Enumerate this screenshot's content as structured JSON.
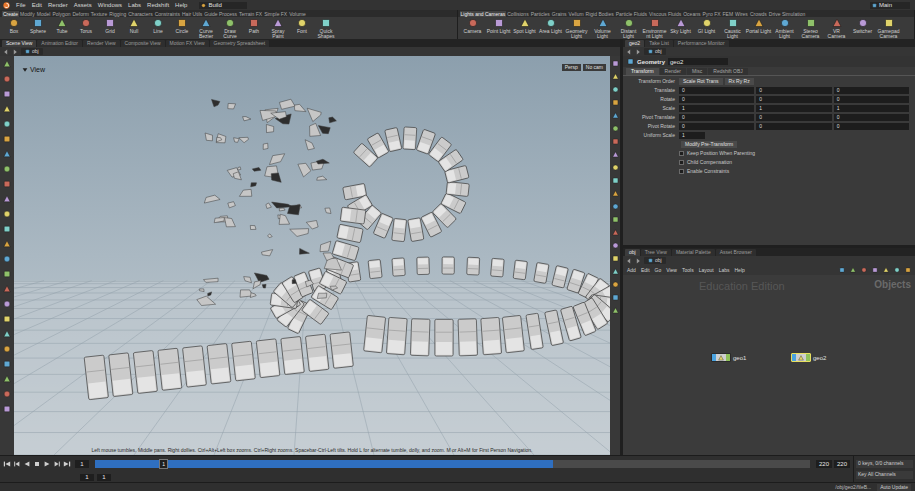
{
  "menu_bar": {
    "items": [
      "File",
      "Edit",
      "Render",
      "Assets",
      "Windows",
      "Labs",
      "Redshift",
      "Help"
    ],
    "desktop": "Build",
    "main": "Main"
  },
  "shelf": {
    "left_tabs": [
      {
        "label": "Create",
        "selected": true
      },
      {
        "label": "Modify",
        "selected": false
      },
      {
        "label": "Model",
        "selected": false
      },
      {
        "label": "Polygon",
        "selected": false
      },
      {
        "label": "Deform",
        "selected": false
      },
      {
        "label": "Texture",
        "selected": false
      },
      {
        "label": "Rigging",
        "selected": false
      },
      {
        "label": "Characters",
        "selected": false
      },
      {
        "label": "Constraints",
        "selected": false
      },
      {
        "label": "Hair Utils",
        "selected": false
      },
      {
        "label": "Guide Process",
        "selected": false
      },
      {
        "label": "Terrain FX",
        "selected": false
      },
      {
        "label": "Simple FX",
        "selected": false
      },
      {
        "label": "Volume",
        "selected": false
      }
    ],
    "left_tools": [
      "Box",
      "Sphere",
      "Tube",
      "Torus",
      "Grid",
      "Null",
      "Line",
      "Circle",
      "Curve Bezier",
      "Draw Curve",
      "Path",
      "Spray Paint",
      "Font",
      "Quick Shapes"
    ],
    "right_tabs": [
      {
        "label": "Lights and Cameras",
        "selected": true
      },
      {
        "label": "Collisions",
        "selected": false
      },
      {
        "label": "Particles",
        "selected": false
      },
      {
        "label": "Grains",
        "selected": false
      },
      {
        "label": "Vellum",
        "selected": false
      },
      {
        "label": "Rigid Bodies",
        "selected": false
      },
      {
        "label": "Particle Fluids",
        "selected": false
      },
      {
        "label": "Viscous Fluids",
        "selected": false
      },
      {
        "label": "Oceans",
        "selected": false
      },
      {
        "label": "Pyro FX",
        "selected": false
      },
      {
        "label": "FEM",
        "selected": false
      },
      {
        "label": "Wires",
        "selected": false
      },
      {
        "label": "Crowds",
        "selected": false
      },
      {
        "label": "Drive Simulation",
        "selected": false
      }
    ],
    "right_tools": [
      "Camera",
      "Point Light",
      "Spot Light",
      "Area Light",
      "Geometry Light",
      "Volume Light",
      "Distant Light",
      "Environment Light",
      "Sky Light",
      "GI Light",
      "Caustic Light",
      "Portal Light",
      "Ambient Light",
      "Stereo Camera",
      "VR Camera",
      "Switcher",
      "Gamepad Camera"
    ]
  },
  "viewer": {
    "tabs": [
      {
        "label": "Scene View",
        "selected": true
      },
      {
        "label": "Animation Editor",
        "selected": false
      },
      {
        "label": "Render View",
        "selected": false
      },
      {
        "label": "Composite View",
        "selected": false
      },
      {
        "label": "Motion FX View",
        "selected": false
      },
      {
        "label": "Geometry Spreadsheet",
        "selected": false
      }
    ],
    "path": "obj",
    "title": "View",
    "camera_buttons": [
      "Persp",
      "No cam"
    ],
    "hint": "Left mouse tumbles. Middle pans. Right dollies. Ctrl+Alt+Left box zooms. Ctrl+Right zooms. Spacebar-Ctrl-Left tilts. Hold L for alternate tumble, dolly, and zoom. M or Alt+M for First Person Navigation."
  },
  "parameters": {
    "tabs": [
      {
        "label": "geo2",
        "selected": true
      },
      {
        "label": "Take List",
        "selected": false
      },
      {
        "label": "Performance Monitor",
        "selected": false
      }
    ],
    "path": "obj",
    "node_type": "Geometry",
    "node_name": "geo2",
    "page_tabs": [
      {
        "label": "Transform",
        "selected": true
      },
      {
        "label": "Render",
        "selected": false
      },
      {
        "label": "Misc",
        "selected": false
      },
      {
        "label": "Redshift OBJ",
        "selected": false
      }
    ],
    "transform_order": {
      "label": "Transform Order",
      "values": [
        "Scale Rot Trans",
        "Rx Ry Rz"
      ]
    },
    "vectors": [
      {
        "label": "Translate",
        "values": [
          "0",
          "0",
          "0"
        ]
      },
      {
        "label": "Rotate",
        "values": [
          "0",
          "0",
          "0"
        ]
      },
      {
        "label": "Scale",
        "values": [
          "1",
          "1",
          "1"
        ]
      },
      {
        "label": "Pivot Translate",
        "values": [
          "0",
          "0",
          "0"
        ]
      },
      {
        "label": "Pivot Rotate",
        "values": [
          "0",
          "0",
          "0"
        ]
      }
    ],
    "uniform_scale": {
      "label": "Uniform Scale",
      "value": "1"
    },
    "pre_transform": "Modify Pre-Transform",
    "toggles": [
      {
        "label": "Keep Position When Parenting",
        "checked": false
      },
      {
        "label": "Child Compensation",
        "checked": false
      },
      {
        "label": "Enable Constraints",
        "checked": false
      }
    ]
  },
  "network": {
    "tabs": [
      {
        "label": "obj",
        "selected": true
      },
      {
        "label": "Tree View",
        "selected": false
      },
      {
        "label": "Material Palette",
        "selected": false
      },
      {
        "label": "Asset Browser",
        "selected": false
      }
    ],
    "path": "obj",
    "menu": [
      "Add",
      "Edit",
      "Go",
      "View",
      "Tools",
      "Layout",
      "Labs",
      "Help"
    ],
    "watermark": "Education Edition",
    "context": "Objects",
    "nodes": [
      {
        "name": "geo1",
        "selected": false
      },
      {
        "name": "geo2",
        "selected": true
      }
    ]
  },
  "timeline": {
    "frame": "1",
    "playhead_label": "1",
    "playhead": 0.09,
    "cached_level": 0.64,
    "start": "1",
    "range_start": "1",
    "end": "220",
    "range_end": "220"
  },
  "keys": {
    "summary": "0 keys, 0/0 channels",
    "key_all": "Key All Channels"
  },
  "status_bar": {
    "path": "/obj/geo2/fileB...",
    "update_mode": "Auto Update"
  }
}
